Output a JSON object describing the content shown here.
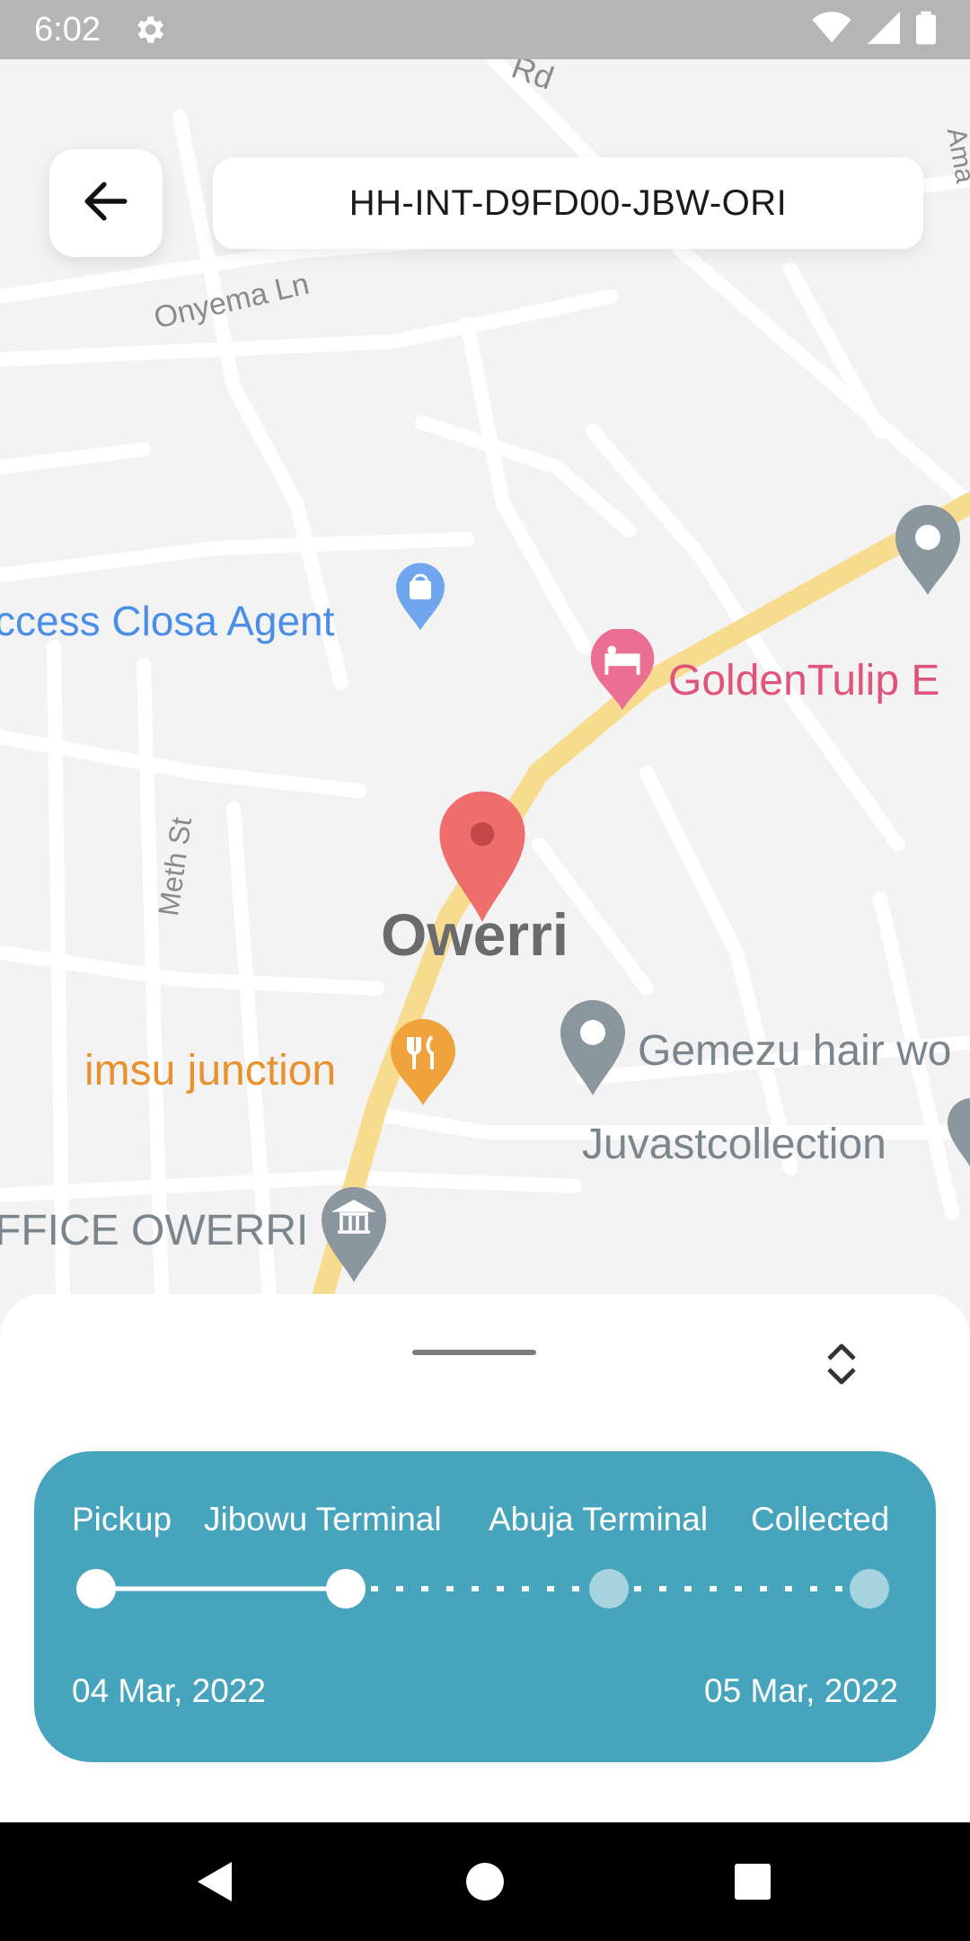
{
  "status_bar": {
    "time": "6:02",
    "icons": [
      "gear-icon",
      "wifi-icon",
      "signal-icon",
      "battery-icon"
    ]
  },
  "header": {
    "back_icon": "arrow-left-icon",
    "tracking_code": "HH-INT-D9FD00-JBW-ORI"
  },
  "map": {
    "streets": [
      "Onyema Ln",
      "Meth St",
      "Rd",
      "Ama"
    ],
    "city": "Owerri",
    "places": [
      {
        "name": "ccess Closa Agent",
        "icon": "shopping-bag-icon",
        "color": "#4a8fe7"
      },
      {
        "name": "GoldenTulip E",
        "icon": "hotel-bed-icon",
        "color": "#e0547c"
      },
      {
        "name": "imsu junction",
        "icon": "restaurant-icon",
        "color": "#e8912d"
      },
      {
        "name": "Gemezu hair wo",
        "icon": "place-pin-icon",
        "color": "#6f7c86"
      },
      {
        "name": "Juvastcollection",
        "icon": "place-pin-icon",
        "color": "#6f7c86"
      },
      {
        "name": "FFICE OWERRI",
        "icon": "government-icon",
        "color": "#6f7c86"
      }
    ],
    "road_color": "#f7dc8f",
    "pin_color": "#ee6e6e"
  },
  "sheet": {
    "handle_icon": "drag-handle",
    "toggle_icon": "expand-collapse-icon",
    "progress": {
      "stages": [
        "Pickup",
        "Jibowu Terminal",
        "Abuja Terminal",
        "Collected"
      ],
      "completed_stages": 2,
      "start_date": "04 Mar, 2022",
      "end_date": "05 Mar, 2022",
      "card_color": "#47a4bd"
    }
  },
  "nav_bar": {
    "buttons": [
      "back-triangle-icon",
      "home-circle-icon",
      "recents-square-icon"
    ]
  }
}
